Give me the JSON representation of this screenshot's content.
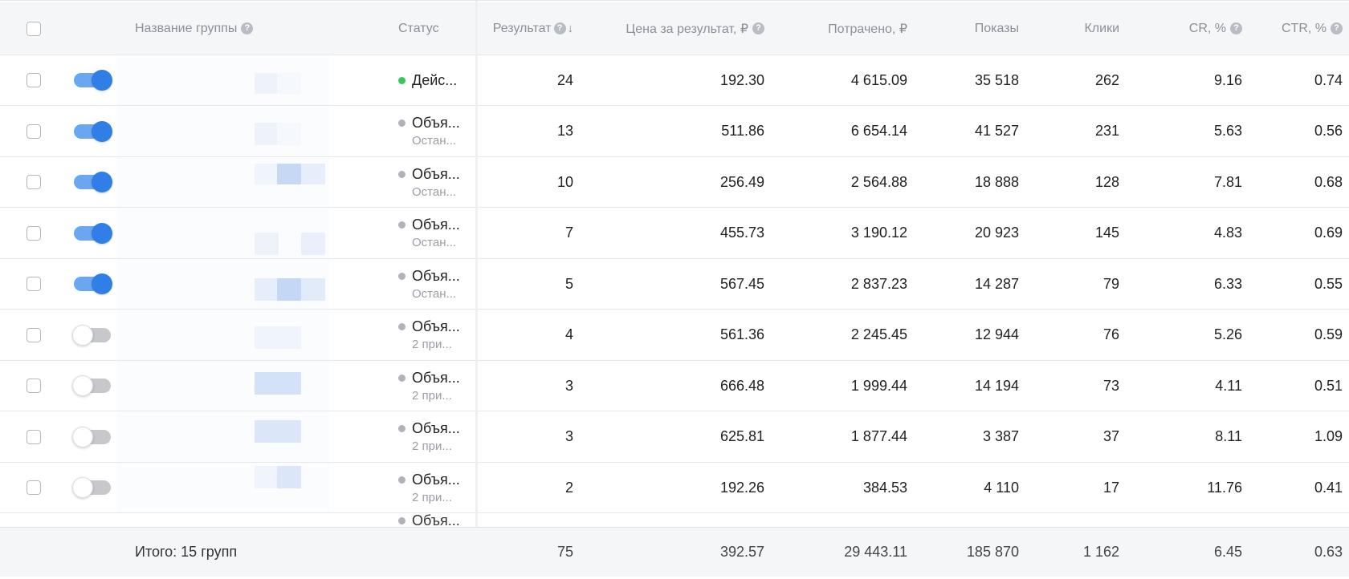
{
  "header": {
    "name_col": "Название группы",
    "status_col": "Статус",
    "result_col": "Результат",
    "sort_icon": "↓",
    "price_col": "Цена за результат, ₽",
    "spent_col": "Потрачено, ₽",
    "impressions_col": "Показы",
    "clicks_col": "Клики",
    "cr_col": "CR, %",
    "ctr_col": "CTR, %",
    "help_glyph": "?"
  },
  "colors": {
    "status_active": "#34c759",
    "status_stopped": "#b0b3b8",
    "toggle_on": "#2f7fe6",
    "footer_bg": "#f5f6f7"
  },
  "rows": [
    {
      "toggle": "on",
      "status_color": "#34c759",
      "status": "Дейс...",
      "status_sub": "",
      "result": "24",
      "price": "192.30",
      "spent": "4 615.09",
      "impressions": "35 518",
      "clicks": "262",
      "cr": "9.16",
      "ctr": "0.74"
    },
    {
      "toggle": "on",
      "status_color": "#b0b3b8",
      "status": "Объя...",
      "status_sub": "Остан...",
      "result": "13",
      "price": "511.86",
      "spent": "6 654.14",
      "impressions": "41 527",
      "clicks": "231",
      "cr": "5.63",
      "ctr": "0.56"
    },
    {
      "toggle": "on",
      "status_color": "#b0b3b8",
      "status": "Объя...",
      "status_sub": "Остан...",
      "result": "10",
      "price": "256.49",
      "spent": "2 564.88",
      "impressions": "18 888",
      "clicks": "128",
      "cr": "7.81",
      "ctr": "0.68"
    },
    {
      "toggle": "on",
      "status_color": "#b0b3b8",
      "status": "Объя...",
      "status_sub": "Остан...",
      "result": "7",
      "price": "455.73",
      "spent": "3 190.12",
      "impressions": "20 923",
      "clicks": "145",
      "cr": "4.83",
      "ctr": "0.69"
    },
    {
      "toggle": "on",
      "status_color": "#b0b3b8",
      "status": "Объя...",
      "status_sub": "Остан...",
      "result": "5",
      "price": "567.45",
      "spent": "2 837.23",
      "impressions": "14 287",
      "clicks": "79",
      "cr": "6.33",
      "ctr": "0.55"
    },
    {
      "toggle": "off",
      "status_color": "#b0b3b8",
      "status": "Объя...",
      "status_sub": "2 при...",
      "result": "4",
      "price": "561.36",
      "spent": "2 245.45",
      "impressions": "12 944",
      "clicks": "76",
      "cr": "5.26",
      "ctr": "0.59"
    },
    {
      "toggle": "off",
      "status_color": "#b0b3b8",
      "status": "Объя...",
      "status_sub": "2 при...",
      "result": "3",
      "price": "666.48",
      "spent": "1 999.44",
      "impressions": "14 194",
      "clicks": "73",
      "cr": "4.11",
      "ctr": "0.51"
    },
    {
      "toggle": "off",
      "status_color": "#b0b3b8",
      "status": "Объя...",
      "status_sub": "2 при...",
      "result": "3",
      "price": "625.81",
      "spent": "1 877.44",
      "impressions": "3 387",
      "clicks": "37",
      "cr": "8.11",
      "ctr": "1.09"
    },
    {
      "toggle": "off",
      "status_color": "#b0b3b8",
      "status": "Объя...",
      "status_sub": "2 при...",
      "result": "2",
      "price": "192.26",
      "spent": "384.53",
      "impressions": "4 110",
      "clicks": "17",
      "cr": "11.76",
      "ctr": "0.41"
    }
  ],
  "partial_row": {
    "status": "Объя..."
  },
  "footer": {
    "label": "Итого: 15 групп",
    "result": "75",
    "price": "392.57",
    "spent": "29 443.11",
    "impressions": "185 870",
    "clicks": "1 162",
    "cr": "6.45",
    "ctr": "0.63"
  }
}
